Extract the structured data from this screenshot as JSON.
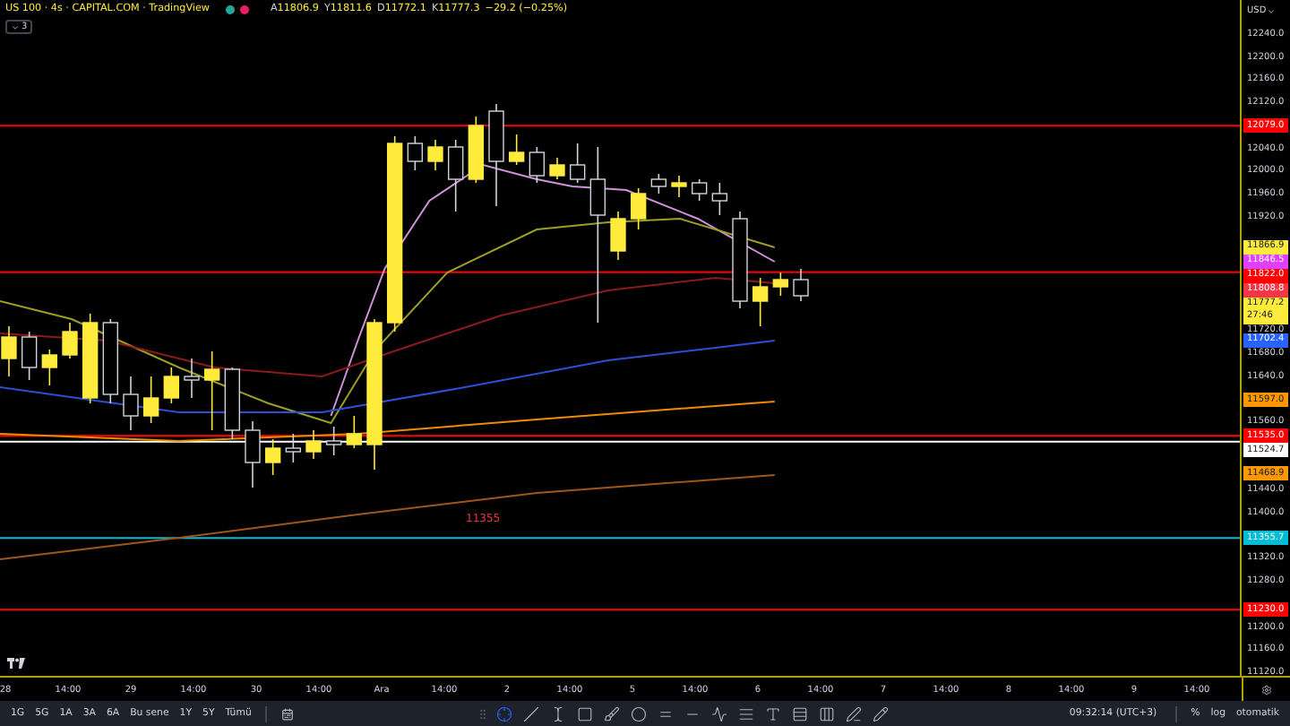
{
  "header": {
    "title": "US 100 · 4s · CAPITAL.COM · TradingView",
    "status_dots": [
      {
        "color": "#26a69a"
      },
      {
        "color": "#e91e63"
      }
    ],
    "ohlc": [
      {
        "label": "A",
        "value": "11806.9"
      },
      {
        "label": "Y",
        "value": "11811.6"
      },
      {
        "label": "D",
        "value": "11772.1"
      },
      {
        "label": "K",
        "value": "11777.3"
      }
    ],
    "change": "−29.2 (−0.25%)",
    "collapse_button": "3"
  },
  "price_axis": {
    "currency": "USD",
    "ticks": [
      "12240.0",
      "12200.0",
      "12160.0",
      "12120.0",
      "12040.0",
      "12000.0",
      "11960.0",
      "11920.0",
      "11720.0",
      "11680.0",
      "11640.0",
      "11560.0",
      "11440.0",
      "11400.0",
      "11320.0",
      "11280.0",
      "11200.0",
      "11160.0",
      "11120.0"
    ],
    "markers": [
      {
        "text": "12079.0",
        "color": "#ff0000",
        "line": true
      },
      {
        "text": "11866.9",
        "color": "#ffeb3b",
        "line": false
      },
      {
        "text": "11846.5",
        "color": "#e040fb",
        "line": false
      },
      {
        "text": "11822.0",
        "color": "#ff0000",
        "line": true
      },
      {
        "text": "11808.8",
        "color": "#f23645",
        "line": false
      },
      {
        "text": "11777.2",
        "subtext": "27:46",
        "color": "#ffeb3b",
        "line": false
      },
      {
        "text": "11702.4",
        "color": "#2962ff",
        "line": false
      },
      {
        "text": "11597.0",
        "color": "#ff9800",
        "line": false
      },
      {
        "text": "11535.0",
        "color": "#ff0000",
        "line": true
      },
      {
        "text": "11524.7",
        "color": "#ffffff",
        "line": true
      },
      {
        "text": "11468.9",
        "color": "#ff9800",
        "line": false
      },
      {
        "text": "11355.7",
        "color": "#00bcd4",
        "line": true
      },
      {
        "text": "11230.0",
        "color": "#ff0000",
        "line": true
      }
    ]
  },
  "chart_annotations": [
    {
      "text": "11355"
    }
  ],
  "time_axis": {
    "labels": [
      "28",
      "14:00",
      "29",
      "14:00",
      "30",
      "14:00",
      "Ara",
      "14:00",
      "2",
      "14:00",
      "5",
      "14:00",
      "6",
      "14:00",
      "7",
      "14:00",
      "8",
      "14:00",
      "9",
      "14:00"
    ]
  },
  "toolbar": {
    "ranges": [
      "1G",
      "5G",
      "1A",
      "3A",
      "6A",
      "Bu sene",
      "1Y",
      "5Y",
      "Tümü"
    ],
    "tools": [
      {
        "kind": "crosshair",
        "selected": true
      },
      {
        "kind": "line",
        "selected": false
      },
      {
        "kind": "text-cursor",
        "selected": false
      },
      {
        "kind": "rectangle",
        "selected": false
      },
      {
        "kind": "brush",
        "selected": false
      },
      {
        "kind": "ellipse",
        "selected": false
      },
      {
        "kind": "parallel",
        "selected": false
      },
      {
        "kind": "horizontal",
        "selected": false
      },
      {
        "kind": "zigzag",
        "selected": false
      },
      {
        "kind": "lines",
        "selected": false
      },
      {
        "kind": "text",
        "selected": false
      },
      {
        "kind": "rows",
        "selected": false
      },
      {
        "kind": "columns",
        "selected": false
      },
      {
        "kind": "pen",
        "selected": false
      },
      {
        "kind": "pencil",
        "selected": false
      }
    ],
    "clock": "09:32:14 (UTC+3)",
    "options": [
      "%",
      "log",
      "otomatik"
    ]
  }
}
